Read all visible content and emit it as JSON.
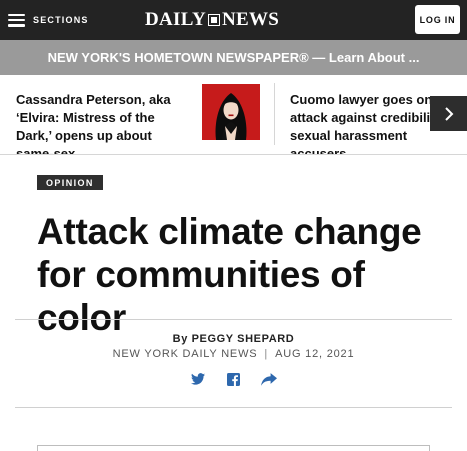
{
  "header": {
    "sections_label": "SECTIONS",
    "logo_left": "DAILY",
    "logo_right": "NEWS",
    "login_label": "LOG IN"
  },
  "promo": {
    "text": "NEW YORK'S HOMETOWN NEWSPAPER® — Learn About ..."
  },
  "top_stories": [
    {
      "headline": "Cassandra Peterson, aka ‘Elvira: Mistress of the Dark,’ opens up about same-sex…"
    },
    {
      "headline": "Cuomo lawyer goes on n… attack against credibility… sexual harassment accusers,…"
    }
  ],
  "article": {
    "section_badge": "OPINION",
    "headline": "Attack climate change for communities of color",
    "byline_prefix": "By",
    "author": "PEGGY SHEPARD",
    "publication": "NEW YORK DAILY NEWS",
    "separator": "|",
    "date": "AUG 12, 2021"
  },
  "share_icons": [
    "twitter-icon",
    "facebook-icon",
    "forward-share-icon"
  ],
  "colors": {
    "topbar": "#232323",
    "promo": "#9a9a9a",
    "share_blue": "#2e68ad",
    "badge": "#2f2f2f"
  }
}
